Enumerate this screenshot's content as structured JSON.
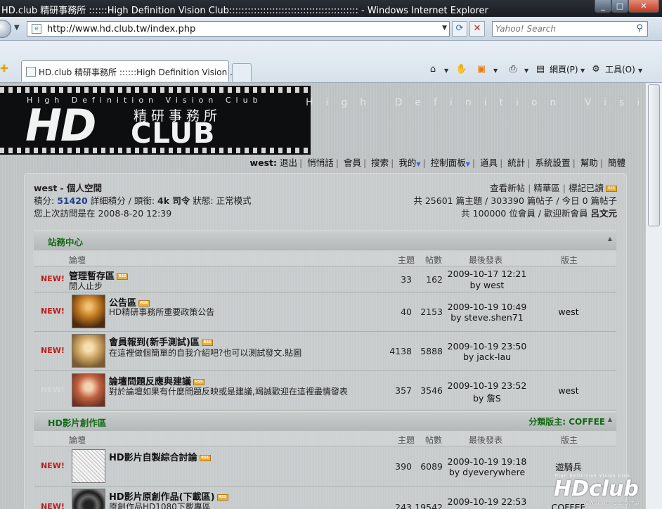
{
  "window": {
    "title": "HD.club 精研事務所 ::::::High Definition Vision Club:::::::::::::::::::::::::::::::::::::::::: - Windows Internet Explorer"
  },
  "address_bar": {
    "url": "http://www.hd.club.tw/index.php"
  },
  "search": {
    "placeholder": "Yahoo! Search"
  },
  "tab": {
    "label": "HD.club 精研事務所 ::::::High Definition Vision ..."
  },
  "command_bar": {
    "page_label": "網頁(P)",
    "tools_label": "工具(O)"
  },
  "banner": {
    "subtitle": "High Definition Vision Club",
    "logo_hd": "HD",
    "logo_club": "CLUB",
    "logo_chinese": "精研事務所",
    "tagline_right": "High Definition Vision Club"
  },
  "top_nav": {
    "username": "west:",
    "items": [
      "退出",
      "悄悄話",
      "會員",
      "搜索",
      "我的",
      "控制面板",
      "道具",
      "統計",
      "系統設置",
      "幫助",
      "簡體"
    ]
  },
  "user_info": {
    "name": "west",
    "space": "- 個人空間",
    "points_label": "積分:",
    "points": "51420",
    "detail_label": "詳細積分 / 頭銜:",
    "title": "4k 司令",
    "status_label": "狀態:",
    "status": "正常模式",
    "last_visit": "您上次訪問是在 2008-8-20 12:39"
  },
  "right_links": {
    "new_posts": "查看新帖",
    "digest": "精華區",
    "mark_read": "標記已讀"
  },
  "stats": {
    "line1": "共 25601 篇主題 / 303390 篇帖子 / 今日 0 篇帖子",
    "line2": "共 100000 位會員 / 歡迎新會員",
    "newest_member": "呂文元"
  },
  "columns": {
    "forum": "論壇",
    "topics": "主題",
    "posts": "帖數",
    "last_post": "最後發表",
    "moderator": "版主"
  },
  "categories": [
    {
      "name": "站務中心",
      "moderator_label": "",
      "forums": [
        {
          "new": "NEW!",
          "name": "管理暫存區",
          "desc": "閒人止步",
          "topics": "33",
          "posts": "162",
          "last_date": "2009-10-17 12:21",
          "last_by": "by west",
          "moderator": ""
        },
        {
          "new": "NEW!",
          "name": "公告區",
          "desc": "HD精研事務所重要政策公告",
          "topics": "40",
          "posts": "2153",
          "last_date": "2009-10-19 10:49",
          "last_by": "by steve.shen71",
          "moderator": "west"
        },
        {
          "new": "NEW!",
          "name": "會員報到(新手測試)區",
          "desc": "在這裡做個簡單的自我介紹吧?也可以測試發文.貼圖",
          "topics": "4138",
          "posts": "5888",
          "last_date": "2009-10-19 23:50",
          "last_by": "by jack-lau",
          "moderator": ""
        },
        {
          "new": "NEW!",
          "name": "論壇問題反應與建議",
          "desc": "對於論壇如果有什麼問題反映或是建議,竭誠歡迎在這裡盡情發表",
          "topics": "357",
          "posts": "3546",
          "last_date": "2009-10-19 23:52",
          "last_by": "by 詹S",
          "moderator": "west"
        }
      ]
    },
    {
      "name": "HD影片創作區",
      "moderator_label": "分類版主: COFFEE",
      "forums": [
        {
          "new": "NEW!",
          "name": "HD影片自製綜合討論",
          "desc": "",
          "topics": "390",
          "posts": "6089",
          "last_date": "2009-10-19 19:18",
          "last_by": "by dyeverywhere",
          "moderator": "遊騎兵"
        },
        {
          "new": "NEW!",
          "name": "HD影片原創作品(下載區)",
          "desc": "原創作品HD1080下載專區",
          "topics": "243",
          "posts": "19542",
          "last_date": "2009-10-19 22:53",
          "last_by": "",
          "moderator": "COFFEE"
        }
      ]
    }
  ],
  "watermark": {
    "small": "High Definition Vision Club",
    "logo": "HDclub",
    "url": "WWW.HD.CLUB.TW"
  }
}
